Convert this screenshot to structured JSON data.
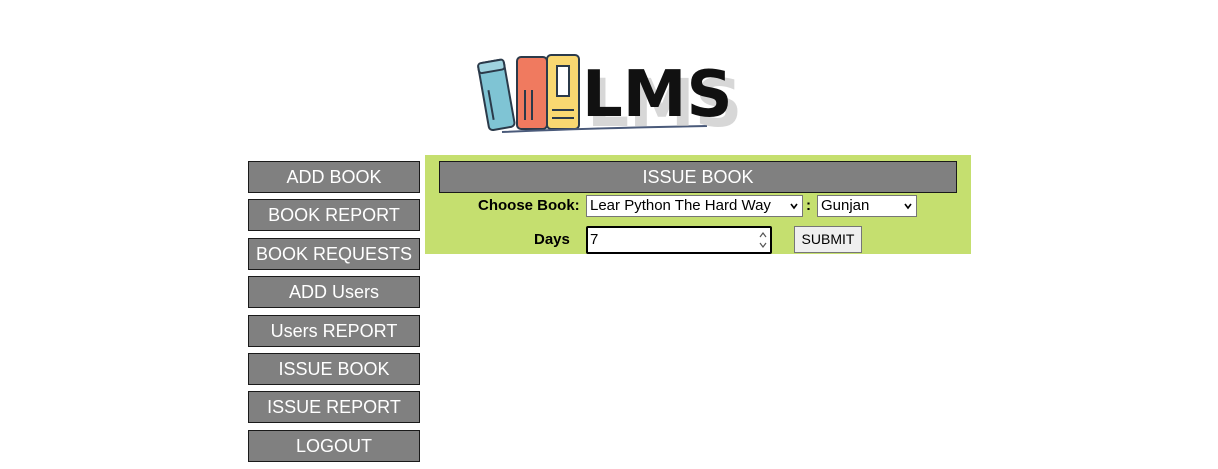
{
  "logo": {
    "text": "LMS"
  },
  "sidebar": {
    "items": [
      {
        "label": "ADD BOOK"
      },
      {
        "label": "BOOK REPORT"
      },
      {
        "label": "BOOK REQUESTS"
      },
      {
        "label": "ADD Users"
      },
      {
        "label": "Users REPORT"
      },
      {
        "label": "ISSUE BOOK"
      },
      {
        "label": "ISSUE REPORT"
      },
      {
        "label": "LOGOUT"
      }
    ]
  },
  "issue_form": {
    "title": "ISSUE BOOK",
    "choose_book_label": "Choose Book:",
    "book_select_value": "Lear Python The Hard Way",
    "separator": ":",
    "user_select_value": "Gunjan",
    "days_label": "Days",
    "days_value": "7",
    "submit_label": "SUBMIT"
  },
  "colors": {
    "button_gray": "#808080",
    "panel_green": "#c5df6f"
  }
}
